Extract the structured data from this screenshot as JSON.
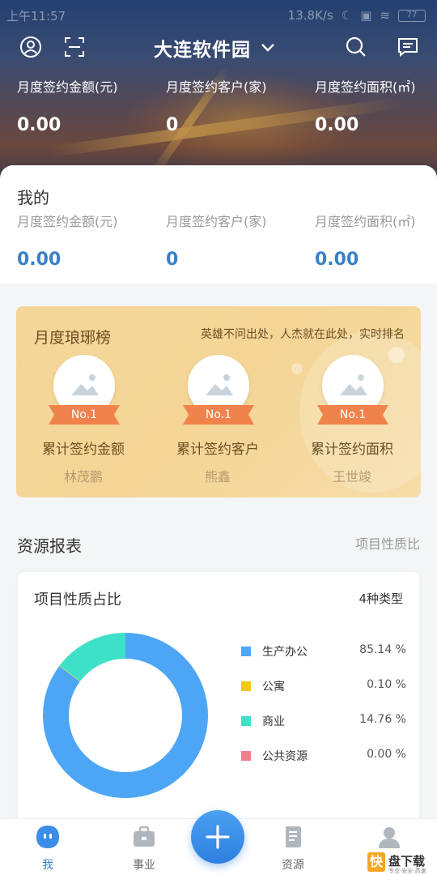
{
  "status_bar": {
    "time": "上午11:57",
    "speed": "13.8K/s",
    "battery": "77"
  },
  "header": {
    "title": "大连软件园"
  },
  "overall_stats": [
    {
      "label": "月度签约金额(元)",
      "value": "0.00"
    },
    {
      "label": "月度签约客户(家)",
      "value": "0"
    },
    {
      "label": "月度签约面积(㎡)",
      "value": "0.00"
    }
  ],
  "mine": {
    "heading": "我的",
    "stats": [
      {
        "label": "月度签约金额(元)",
        "value": "0.00"
      },
      {
        "label": "月度签约客户(家)",
        "value": "0"
      },
      {
        "label": "月度签约面积(㎡)",
        "value": "0.00"
      }
    ]
  },
  "leaderboard": {
    "title": "月度琅琊榜",
    "slogan": "英雄不问出处，人杰就在此处，实时排名",
    "winners": [
      {
        "rank": "No.1",
        "category": "累计签约金额",
        "name": "林茂鹏"
      },
      {
        "rank": "No.1",
        "category": "累计签约客户",
        "name": "熊鑫"
      },
      {
        "rank": "No.1",
        "category": "累计签约面积",
        "name": "王世竣"
      }
    ]
  },
  "report": {
    "section_title": "资源报表",
    "section_link": "项目性质比",
    "card_title": "项目性质占比",
    "type_count": "4种类型"
  },
  "chart_data": {
    "type": "pie",
    "title": "项目性质占比",
    "categories": [
      "生产办公",
      "公寓",
      "商业",
      "公共资源"
    ],
    "values": [
      85.14,
      0.1,
      14.76,
      0.0
    ],
    "value_labels": [
      "85.14 %",
      "0.10 %",
      "14.76 %",
      "0.00 %"
    ],
    "colors": [
      "#4da6f5",
      "#f5c518",
      "#3ee0c8",
      "#f07f8e"
    ],
    "donut": true
  },
  "nav": {
    "items": [
      {
        "label": "我"
      },
      {
        "label": "事业"
      },
      {
        "label": "资源"
      },
      {
        "label": ""
      }
    ]
  },
  "watermark": {
    "badge": "快",
    "text": "盘下载",
    "sub": "专业·安全·高速"
  },
  "colors": {
    "accent": "#3a7fc8",
    "gold": "#f4d596",
    "ribbon": "#f0834c"
  }
}
